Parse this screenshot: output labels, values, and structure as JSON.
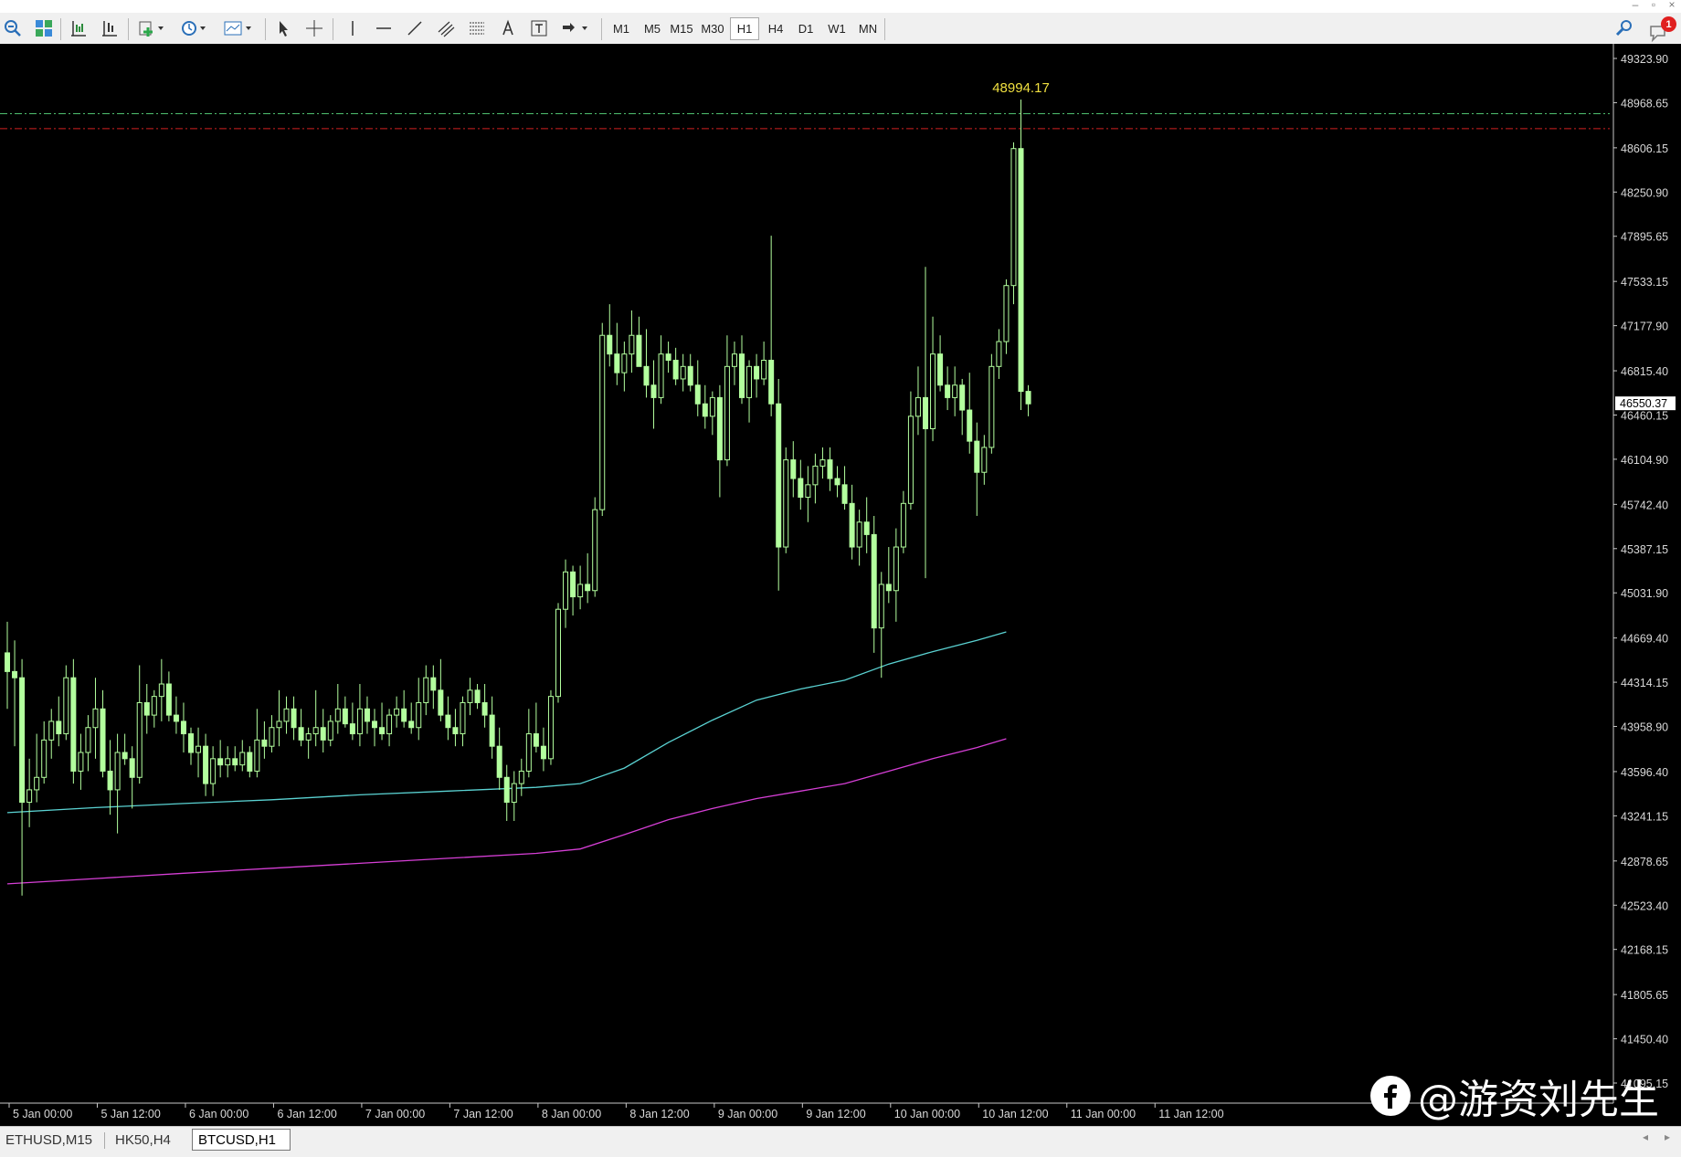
{
  "window": {
    "controls": [
      "–",
      "▫",
      "×"
    ]
  },
  "toolbar": {
    "timeframes": [
      "M1",
      "M5",
      "M15",
      "M30",
      "H1",
      "H4",
      "D1",
      "W1",
      "MN"
    ],
    "active_timeframe": "H1",
    "notification_count": "1"
  },
  "chart_data": {
    "type": "candlestick",
    "symbol": "BTCUSD",
    "timeframe": "H1",
    "ylim": [
      41095.15,
      49323.9
    ],
    "y_ticks": [
      "49323.90",
      "48968.65",
      "48606.15",
      "48250.90",
      "47895.65",
      "47533.15",
      "47177.90",
      "46815.40",
      "46460.15",
      "46104.90",
      "45742.40",
      "45387.15",
      "45031.90",
      "44669.40",
      "44314.15",
      "43958.90",
      "43596.40",
      "43241.15",
      "42878.65",
      "42523.40",
      "42168.15",
      "41805.65",
      "41450.40",
      "41095.15"
    ],
    "x_ticks": [
      "5 Jan 00:00",
      "5 Jan 12:00",
      "6 Jan 00:00",
      "6 Jan 12:00",
      "7 Jan 00:00",
      "7 Jan 12:00",
      "8 Jan 00:00",
      "8 Jan 12:00",
      "9 Jan 00:00",
      "9 Jan 12:00",
      "10 Jan 00:00",
      "10 Jan 12:00",
      "11 Jan 00:00",
      "11 Jan 12:00"
    ],
    "current_price": "46550.37",
    "high_label": "48994.17",
    "hlines": [
      {
        "price": 48880,
        "color": "#4fbf6f",
        "style": "dash-dot"
      },
      {
        "price": 48760,
        "color": "#d02020",
        "style": "dash-dot"
      }
    ],
    "candle_color": "#b3ff9e",
    "moving_averages": [
      {
        "color": "#5ad2d2",
        "points": [
          [
            0,
            43267
          ],
          [
            12,
            43307
          ],
          [
            24,
            43340
          ],
          [
            36,
            43370
          ],
          [
            48,
            43410
          ],
          [
            60,
            43440
          ],
          [
            72,
            43470
          ],
          [
            78,
            43500
          ],
          [
            84,
            43625
          ],
          [
            90,
            43830
          ],
          [
            96,
            44010
          ],
          [
            102,
            44170
          ],
          [
            108,
            44260
          ],
          [
            114,
            44330
          ],
          [
            120,
            44460
          ],
          [
            126,
            44560
          ],
          [
            132,
            44650
          ],
          [
            136,
            44718
          ]
        ]
      },
      {
        "color": "#d63fd6",
        "points": [
          [
            0,
            42695
          ],
          [
            12,
            42737
          ],
          [
            24,
            42780
          ],
          [
            36,
            42820
          ],
          [
            48,
            42860
          ],
          [
            60,
            42900
          ],
          [
            72,
            42940
          ],
          [
            78,
            42975
          ],
          [
            84,
            43090
          ],
          [
            90,
            43210
          ],
          [
            96,
            43300
          ],
          [
            102,
            43380
          ],
          [
            108,
            43440
          ],
          [
            114,
            43500
          ],
          [
            120,
            43600
          ],
          [
            126,
            43700
          ],
          [
            132,
            43790
          ],
          [
            136,
            43860
          ]
        ]
      }
    ],
    "candles": [
      [
        44550,
        44800,
        44100,
        44400
      ],
      [
        44400,
        44650,
        43800,
        44350
      ],
      [
        44350,
        44500,
        42600,
        43350
      ],
      [
        43350,
        43700,
        43150,
        43450
      ],
      [
        43450,
        43900,
        43350,
        43550
      ],
      [
        43550,
        44000,
        43500,
        43850
      ],
      [
        43850,
        44100,
        43700,
        44000
      ],
      [
        44000,
        44200,
        43800,
        43900
      ],
      [
        43900,
        44450,
        43850,
        44350
      ],
      [
        44350,
        44500,
        43500,
        43600
      ],
      [
        43600,
        43900,
        43450,
        43750
      ],
      [
        43750,
        44050,
        43600,
        43950
      ],
      [
        43950,
        44350,
        43700,
        44100
      ],
      [
        44100,
        44250,
        43550,
        43600
      ],
      [
        43600,
        43850,
        43250,
        43450
      ],
      [
        43450,
        43900,
        43100,
        43750
      ],
      [
        43750,
        43900,
        43650,
        43700
      ],
      [
        43700,
        43800,
        43300,
        43550
      ],
      [
        43550,
        44450,
        43500,
        44150
      ],
      [
        44150,
        44300,
        43900,
        44050
      ],
      [
        44050,
        44250,
        43950,
        44200
      ],
      [
        44200,
        44500,
        44000,
        44300
      ],
      [
        44300,
        44400,
        44000,
        44050
      ],
      [
        44050,
        44200,
        43900,
        44000
      ],
      [
        44000,
        44150,
        43750,
        43900
      ],
      [
        43900,
        43950,
        43650,
        43750
      ],
      [
        43750,
        43950,
        43550,
        43800
      ],
      [
        43800,
        43900,
        43400,
        43500
      ],
      [
        43500,
        43800,
        43400,
        43700
      ],
      [
        43700,
        43850,
        43550,
        43650
      ],
      [
        43650,
        43800,
        43550,
        43700
      ],
      [
        43700,
        43800,
        43600,
        43650
      ],
      [
        43650,
        43850,
        43600,
        43750
      ],
      [
        43750,
        43800,
        43550,
        43600
      ],
      [
        43600,
        44100,
        43550,
        43850
      ],
      [
        43850,
        44000,
        43700,
        43800
      ],
      [
        43800,
        44050,
        43750,
        43950
      ],
      [
        43950,
        44250,
        43800,
        44000
      ],
      [
        44000,
        44200,
        43900,
        44100
      ],
      [
        44100,
        44200,
        43850,
        43950
      ],
      [
        43950,
        44100,
        43800,
        43850
      ],
      [
        43850,
        43950,
        43700,
        43900
      ],
      [
        43900,
        44250,
        43800,
        43950
      ],
      [
        43950,
        44100,
        43750,
        43850
      ],
      [
        43850,
        44050,
        43800,
        44000
      ],
      [
        44000,
        44300,
        43900,
        44100
      ],
      [
        44100,
        44200,
        43950,
        43980
      ],
      [
        43980,
        44150,
        43850,
        43900
      ],
      [
        43900,
        44300,
        43800,
        44100
      ],
      [
        44100,
        44200,
        43900,
        44000
      ],
      [
        44000,
        44100,
        43800,
        43950
      ],
      [
        43950,
        44150,
        43850,
        43900
      ],
      [
        43900,
        44100,
        43800,
        44050
      ],
      [
        44050,
        44200,
        43950,
        44100
      ],
      [
        44100,
        44250,
        43950,
        44000
      ],
      [
        44000,
        44150,
        43900,
        43950
      ],
      [
        43950,
        44350,
        43850,
        44150
      ],
      [
        44150,
        44450,
        44050,
        44350
      ],
      [
        44350,
        44450,
        44100,
        44250
      ],
      [
        44250,
        44500,
        44000,
        44050
      ],
      [
        44050,
        44200,
        43850,
        43950
      ],
      [
        43950,
        44100,
        43800,
        43900
      ],
      [
        43900,
        44200,
        43800,
        44150
      ],
      [
        44150,
        44350,
        44050,
        44250
      ],
      [
        44250,
        44300,
        44100,
        44150
      ],
      [
        44150,
        44300,
        43950,
        44050
      ],
      [
        44050,
        44200,
        43700,
        43800
      ],
      [
        43800,
        43950,
        43450,
        43550
      ],
      [
        43550,
        43650,
        43200,
        43350
      ],
      [
        43350,
        43600,
        43200,
        43500
      ],
      [
        43500,
        43700,
        43400,
        43600
      ],
      [
        43600,
        44100,
        43550,
        43900
      ],
      [
        43900,
        44150,
        43750,
        43800
      ],
      [
        43800,
        43950,
        43600,
        43700
      ],
      [
        43700,
        44250,
        43650,
        44200
      ],
      [
        44200,
        44950,
        44150,
        44900
      ],
      [
        44900,
        45300,
        44750,
        45200
      ],
      [
        45200,
        45250,
        44850,
        45000
      ],
      [
        45000,
        45250,
        44900,
        45100
      ],
      [
        45100,
        45350,
        44950,
        45050
      ],
      [
        45050,
        45800,
        45000,
        45700
      ],
      [
        45700,
        47200,
        45650,
        47100
      ],
      [
        47100,
        47350,
        46850,
        46950
      ],
      [
        46950,
        47200,
        46700,
        46800
      ],
      [
        46800,
        47050,
        46650,
        46950
      ],
      [
        46950,
        47300,
        46800,
        47100
      ],
      [
        47100,
        47250,
        46900,
        46850
      ],
      [
        46850,
        47150,
        46600,
        46700
      ],
      [
        46700,
        46900,
        46350,
        46600
      ],
      [
        46600,
        47100,
        46550,
        46950
      ],
      [
        46950,
        47050,
        46800,
        46900
      ],
      [
        46900,
        47000,
        46700,
        46750
      ],
      [
        46750,
        46950,
        46650,
        46850
      ],
      [
        46850,
        46950,
        46650,
        46700
      ],
      [
        46700,
        46900,
        46450,
        46550
      ],
      [
        46550,
        46700,
        46350,
        46450
      ],
      [
        46450,
        46650,
        46300,
        46600
      ],
      [
        46600,
        46700,
        45800,
        46100
      ],
      [
        46100,
        47100,
        46050,
        46850
      ],
      [
        46850,
        47050,
        46700,
        46950
      ],
      [
        46950,
        47100,
        46550,
        46600
      ],
      [
        46600,
        46900,
        46400,
        46850
      ],
      [
        46850,
        46950,
        46600,
        46750
      ],
      [
        46750,
        47050,
        46700,
        46900
      ],
      [
        46900,
        47900,
        46450,
        46550
      ],
      [
        46550,
        46750,
        45050,
        45400
      ],
      [
        45400,
        46200,
        45350,
        46100
      ],
      [
        46100,
        46250,
        45800,
        45950
      ],
      [
        45950,
        46100,
        45700,
        45800
      ],
      [
        45800,
        46050,
        45600,
        45900
      ],
      [
        45900,
        46150,
        45750,
        46050
      ],
      [
        46050,
        46200,
        45950,
        46100
      ],
      [
        46100,
        46200,
        45850,
        45950
      ],
      [
        45950,
        46050,
        45800,
        45900
      ],
      [
        45900,
        46050,
        45700,
        45750
      ],
      [
        45750,
        45900,
        45300,
        45400
      ],
      [
        45400,
        45700,
        45250,
        45600
      ],
      [
        45600,
        45800,
        45350,
        45500
      ],
      [
        45500,
        45650,
        44550,
        44750
      ],
      [
        44750,
        45200,
        44350,
        45100
      ],
      [
        45100,
        45400,
        44950,
        45050
      ],
      [
        45050,
        45550,
        44800,
        45400
      ],
      [
        45400,
        45850,
        45350,
        45750
      ],
      [
        45750,
        46650,
        45700,
        46450
      ],
      [
        46450,
        46850,
        46300,
        46600
      ],
      [
        46600,
        47650,
        45150,
        46350
      ],
      [
        46350,
        47250,
        46250,
        46950
      ],
      [
        46950,
        47100,
        46650,
        46700
      ],
      [
        46700,
        46850,
        46500,
        46600
      ],
      [
        46600,
        46850,
        46450,
        46700
      ],
      [
        46700,
        46750,
        46300,
        46500
      ],
      [
        46500,
        46800,
        46150,
        46250
      ],
      [
        46250,
        46400,
        45650,
        46000
      ],
      [
        46000,
        46300,
        45900,
        46200
      ],
      [
        46200,
        46950,
        46150,
        46850
      ],
      [
        46850,
        47150,
        46750,
        47050
      ],
      [
        47050,
        47550,
        46950,
        47500
      ],
      [
        47500,
        48650,
        47350,
        48600
      ],
      [
        48600,
        48994,
        46500,
        46650
      ],
      [
        46650,
        46700,
        46450,
        46550
      ]
    ]
  }
}
